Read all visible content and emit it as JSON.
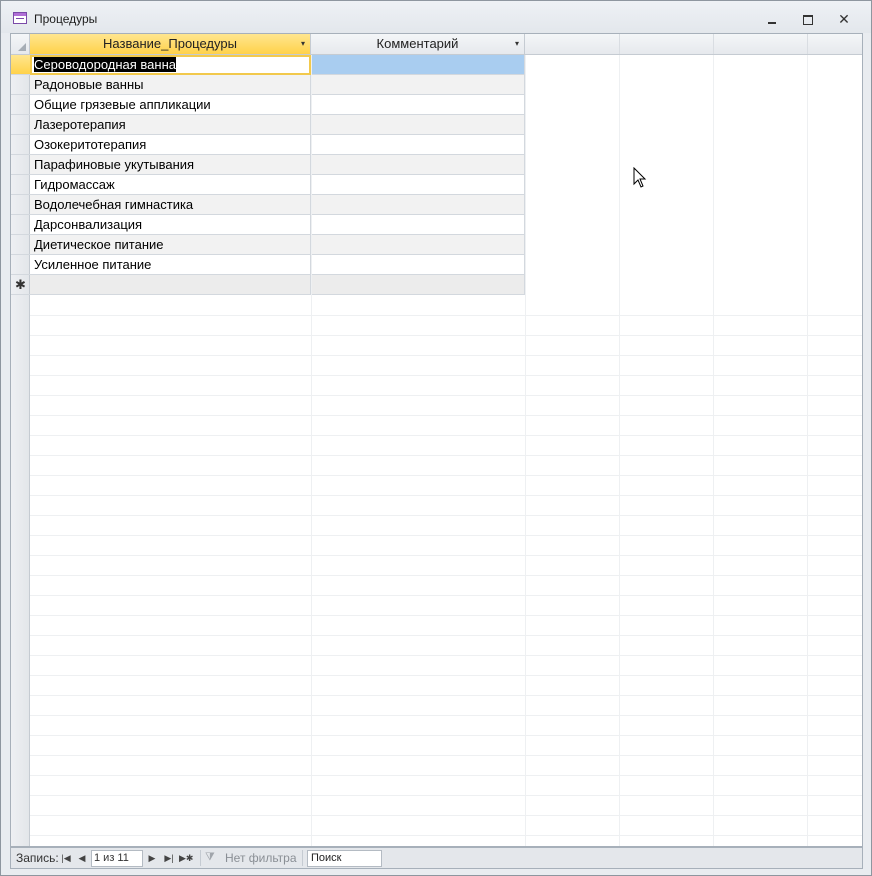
{
  "window": {
    "title": "Процедуры"
  },
  "table": {
    "columns": [
      {
        "label": "Название_Процедуры",
        "sort_indicator": "▾"
      },
      {
        "label": "Комментарий",
        "sort_indicator": "▾"
      }
    ],
    "rows": [
      "Сероводородная ванна",
      "Радоновые ванны",
      "Общие грязевые аппликации",
      "Лазеротерапия",
      "Озокеритотерапия",
      "Парафиновые укутывания",
      "Гидромассаж",
      "Водолечебная гимнастика",
      "Дарсонвализация",
      "Диетическое питание",
      "Усиленное питание"
    ],
    "new_row_marker": "✱"
  },
  "navigation": {
    "label": "Запись:",
    "position": "1 из 11",
    "filter_label": "Нет фильтра",
    "search_placeholder": "Поиск"
  }
}
